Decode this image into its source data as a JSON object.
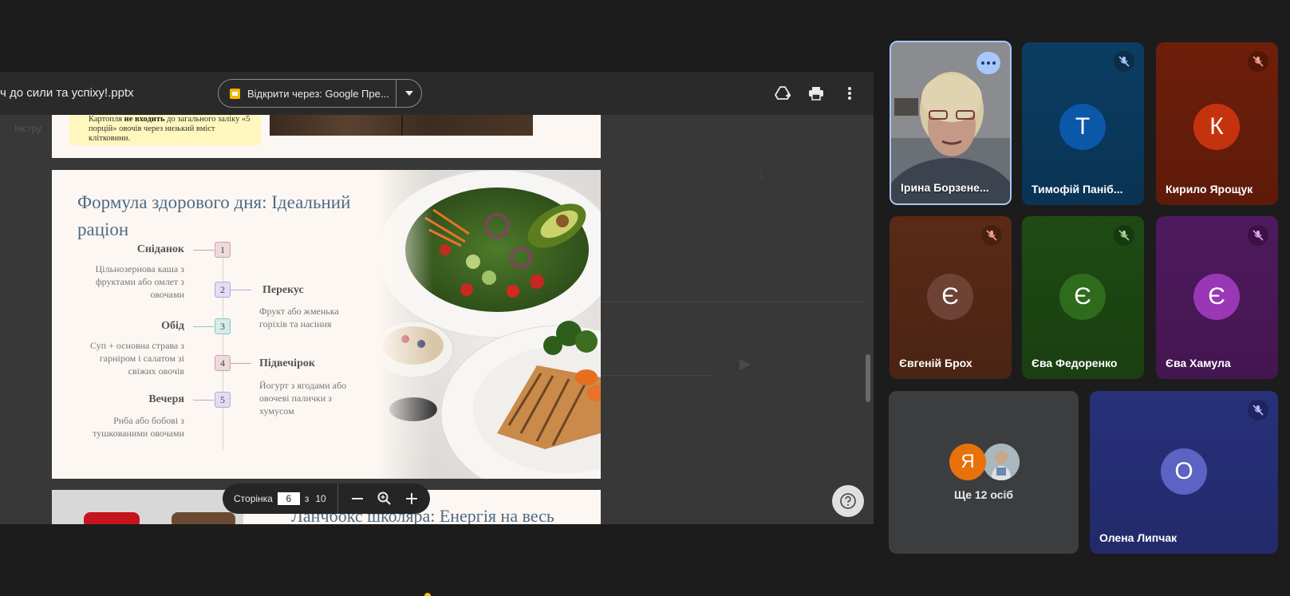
{
  "viewer": {
    "file_name": "ч до сили та успіху!.pptx",
    "open_with_label": "Відкрити через: Google Пре...",
    "ghost_tab": "Інстру",
    "note_text_before": "Картопля ",
    "note_text_bold": "не входить",
    "note_text_after": " до загального заліку «5 порцій» овочів через низький вміст клітковини."
  },
  "slide": {
    "title": "Формула здорового дня: Ідеальний раціон",
    "meals": [
      {
        "num": "1",
        "title": "Сніданок",
        "desc": "Цільнозернова каша з фруктами або омлет з овочами"
      },
      {
        "num": "2",
        "title": "Перекус",
        "desc": "Фрукт або жменька горіхів та насіння"
      },
      {
        "num": "3",
        "title": "Обід",
        "desc": "Суп + основна страва з гарніром і салатом зі свіжих овочів"
      },
      {
        "num": "4",
        "title": "Підвечірок",
        "desc": "Йогурт з ягодами або овочеві палички з хумусом"
      },
      {
        "num": "5",
        "title": "Вечеря",
        "desc": "Риба або бобові з тушкованими овочами"
      }
    ]
  },
  "next_slide": {
    "title": "Ланчбокс школяра: Енергія на весь"
  },
  "page_bar": {
    "label": "Сторінка",
    "current": "6",
    "sep": "з",
    "total": "10"
  },
  "participants": [
    {
      "name": "Ірина Борзене...",
      "type": "video"
    },
    {
      "name": "Тимофій Паніб...",
      "initial": "Т",
      "bg": "#0b3d63",
      "avatar": "#0b57a8"
    },
    {
      "name": "Кирило Ярощук",
      "initial": "К",
      "bg": "#6e1f0a",
      "avatar": "#c5330e"
    },
    {
      "name": "Євгеній Брох",
      "initial": "Є",
      "bg": "#5a2a16",
      "avatar": "#6e4235"
    },
    {
      "name": "Єва Федоренко",
      "initial": "Є",
      "bg": "#1f4a14",
      "avatar": "#2f6b1c"
    },
    {
      "name": "Єва Хамула",
      "initial": "Є",
      "bg": "#4e1a5e",
      "avatar": "#9a37b4"
    },
    {
      "name": "Олена Липчак",
      "initial": "О",
      "bg": "#27317a",
      "avatar": "#5c63c2"
    }
  ],
  "others": {
    "label": "Ще 12 осіб",
    "initial": "Я"
  },
  "colors": {
    "accent": "#a8c7fa",
    "title_blue": "#4f6a86"
  }
}
